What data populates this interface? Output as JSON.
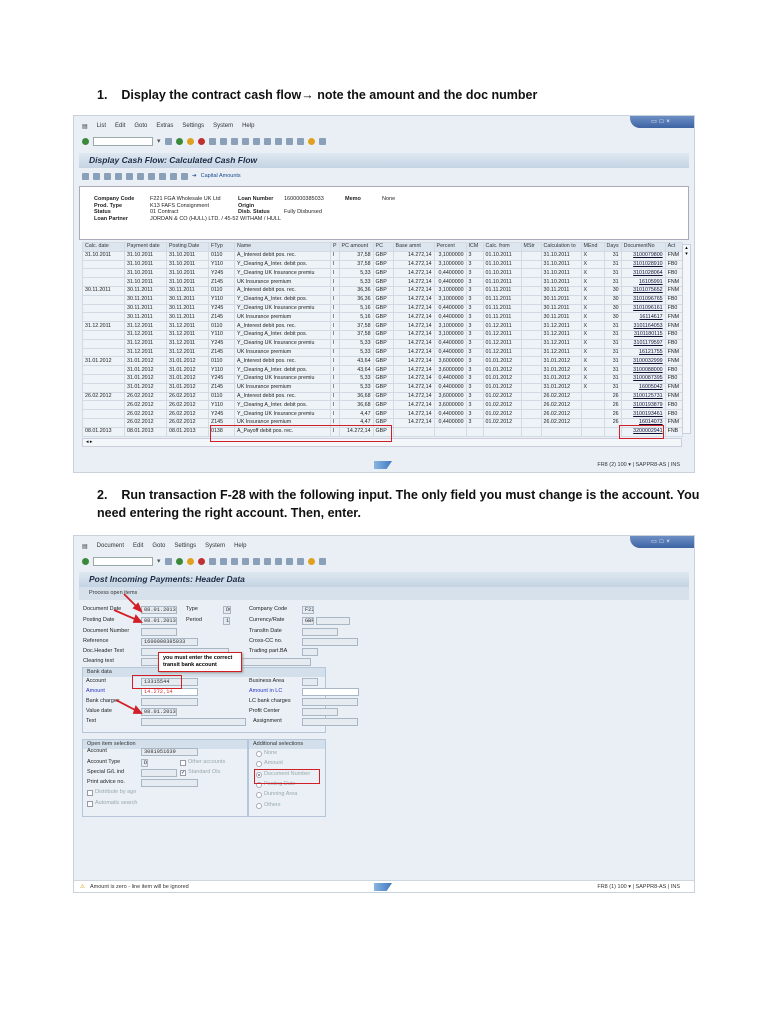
{
  "step1": {
    "number": "1.",
    "text": "Display the contract cash flow→ note the amount and the doc number"
  },
  "step2": {
    "number": "2.",
    "line1": "Run transaction F-28 with the following input. The only field you must change is the account. You",
    "line2": "need entering the right account. Then, enter."
  },
  "screen1": {
    "menu": [
      "List",
      "Edit",
      "Goto",
      "Extras",
      "Settings",
      "System",
      "Help"
    ],
    "title": "Display Cash Flow: Calculated Cash Flow",
    "capital_amounts": "Capital Amounts",
    "header": {
      "company_code_label": "Company Code",
      "company_code": "F221 FGA Wholesale UK Ltd",
      "prod_type_label": "Prod. Type",
      "prod_type": "K13   FAFS Consignment",
      "status_label": "Status",
      "status": "01    Contract",
      "loan_partner_label": "Loan Partner",
      "loan_partner": "JORDAN & CO (HULL) LTD. / 45-52 WITHAM / HULL",
      "loan_number_label": "Loan Number",
      "loan_number": "1600000385033",
      "origin_label": "Origin",
      "disb_status_label": "Disb. Status",
      "disb_status": "Fully Disbursed",
      "memo_label": "Memo",
      "memo": "None"
    },
    "columns": [
      "Calc. date",
      "Payment date",
      "Posting Date",
      "FTyp",
      "Name",
      "P",
      "PC amount",
      "PC",
      "Base amnt",
      "Percent",
      "ICM",
      "Calc. from",
      "MStr",
      "Calculation to",
      "MEnd",
      "Days",
      "DocumentNo",
      "Act"
    ],
    "rows": [
      [
        "31.10.2011",
        "31.10.2011",
        "31.10.2011",
        "0110",
        "A_Interest debit pos. rec.",
        "I",
        "37,58",
        "GBP",
        "14.272,14",
        "3,1000000",
        "3",
        "01.10.2011",
        "",
        "31.10.2011",
        "X",
        "31",
        "3100079800",
        "FNM"
      ],
      [
        "",
        "31.10.2011",
        "31.10.2011",
        "Y110",
        "Y_Clearing A_Inter. debit pos.",
        "I",
        "37,58",
        "GBP",
        "14.272,14",
        "3,1000000",
        "3",
        "01.10.2011",
        "",
        "31.10.2011",
        "X",
        "31",
        "3101028910",
        "FB0"
      ],
      [
        "",
        "31.10.2011",
        "31.10.2011",
        "Y245",
        "Y_Clearing UK Insurance premiu",
        "I",
        "5,33",
        "GBP",
        "14.272,14",
        "0,4400000",
        "3",
        "01.10.2011",
        "",
        "31.10.2011",
        "X",
        "31",
        "3101028064",
        "FB0"
      ],
      [
        "",
        "31.10.2011",
        "31.10.2011",
        "Z145",
        "UK Insurance premium",
        "I",
        "5,33",
        "GBP",
        "14.272,14",
        "0,4400000",
        "3",
        "01.10.2011",
        "",
        "31.10.2011",
        "X",
        "31",
        "16105991",
        "FNM"
      ],
      [
        "30.11.2011",
        "30.11.2011",
        "30.11.2011",
        "0110",
        "A_Interest debit pos. rec.",
        "I",
        "36,36",
        "GBP",
        "14.272,14",
        "3,1000000",
        "3",
        "01.11.2011",
        "",
        "30.11.2011",
        "X",
        "30",
        "3101075652",
        "FNM"
      ],
      [
        "",
        "30.11.2011",
        "30.11.2011",
        "Y110",
        "Y_Clearing A_Inter. debit pos.",
        "I",
        "36,36",
        "GBP",
        "14.272,14",
        "3,1000000",
        "3",
        "01.11.2011",
        "",
        "30.11.2011",
        "X",
        "30",
        "3101096765",
        "FB0"
      ],
      [
        "",
        "30.11.2011",
        "30.11.2011",
        "Y245",
        "Y_Clearing UK Insurance premiu",
        "I",
        "5,16",
        "GBP",
        "14.272,14",
        "0,4400000",
        "3",
        "01.11.2011",
        "",
        "30.11.2011",
        "X",
        "30",
        "3101096161",
        "FB0"
      ],
      [
        "",
        "30.11.2011",
        "30.11.2011",
        "Z145",
        "UK Insurance premium",
        "I",
        "5,16",
        "GBP",
        "14.272,14",
        "0,4400000",
        "3",
        "01.11.2011",
        "",
        "30.11.2011",
        "X",
        "30",
        "16114617",
        "FNM"
      ],
      [
        "31.12.2011",
        "31.12.2011",
        "31.12.2011",
        "0110",
        "A_Interest debit pos. rec.",
        "I",
        "37,58",
        "GBP",
        "14.272,14",
        "3,1000000",
        "3",
        "01.12.2011",
        "",
        "31.12.2011",
        "X",
        "31",
        "3101164053",
        "FNM"
      ],
      [
        "",
        "31.12.2011",
        "31.12.2011",
        "Y110",
        "Y_Clearing A_Inter. debit pos.",
        "I",
        "37,58",
        "GBP",
        "14.272,14",
        "3,1000000",
        "3",
        "01.12.2011",
        "",
        "31.12.2011",
        "X",
        "31",
        "3101180115",
        "FB0"
      ],
      [
        "",
        "31.12.2011",
        "31.12.2011",
        "Y245",
        "Y_Clearing UK Insurance premiu",
        "I",
        "5,33",
        "GBP",
        "14.272,14",
        "0,4400000",
        "3",
        "01.12.2011",
        "",
        "31.12.2011",
        "X",
        "31",
        "3101179597",
        "FB0"
      ],
      [
        "",
        "31.12.2011",
        "31.12.2011",
        "Z145",
        "UK Insurance premium",
        "I",
        "5,33",
        "GBP",
        "14.272,14",
        "0,4400000",
        "3",
        "01.12.2011",
        "",
        "31.12.2011",
        "X",
        "31",
        "16121755",
        "FNM"
      ],
      [
        "31.01.2012",
        "31.01.2012",
        "31.01.2012",
        "0110",
        "A_Interest debit pos. rec.",
        "I",
        "43,64",
        "GBP",
        "14.272,14",
        "3,6000000",
        "3",
        "01.01.2012",
        "",
        "31.01.2012",
        "X",
        "31",
        "3100032999",
        "FNM"
      ],
      [
        "",
        "31.01.2012",
        "31.01.2012",
        "Y110",
        "Y_Clearing A_Inter. debit pos.",
        "I",
        "43,64",
        "GBP",
        "14.272,14",
        "3,6000000",
        "3",
        "01.01.2012",
        "",
        "31.01.2012",
        "X",
        "31",
        "3100088000",
        "FB0"
      ],
      [
        "",
        "31.01.2012",
        "31.01.2012",
        "Y245",
        "Y_Clearing UK Insurance premiu",
        "I",
        "5,33",
        "GBP",
        "14.272,14",
        "0,4400000",
        "3",
        "01.01.2012",
        "",
        "31.01.2012",
        "X",
        "31",
        "3100087395",
        "FB0"
      ],
      [
        "",
        "31.01.2012",
        "31.01.2012",
        "Z145",
        "UK Insurance premium",
        "I",
        "5,33",
        "GBP",
        "14.272,14",
        "0,4400000",
        "3",
        "01.01.2012",
        "",
        "31.01.2012",
        "X",
        "31",
        "16005042",
        "FNM"
      ],
      [
        "26.02.2012",
        "26.02.2012",
        "26.02.2012",
        "0110",
        "A_Interest debit pos. rec.",
        "I",
        "36,68",
        "GBP",
        "14.272,14",
        "3,6000000",
        "3",
        "01.02.2012",
        "",
        "26.02.2012",
        "",
        "26",
        "3100125731",
        "FNM"
      ],
      [
        "",
        "26.02.2012",
        "26.02.2012",
        "Y110",
        "Y_Clearing A_Inter. debit pos.",
        "I",
        "36,68",
        "GBP",
        "14.272,14",
        "3,6000000",
        "3",
        "01.02.2012",
        "",
        "26.02.2012",
        "",
        "26",
        "3100193879",
        "FB0"
      ],
      [
        "",
        "26.02.2012",
        "26.02.2012",
        "Y245",
        "Y_Clearing UK Insurance premiu",
        "I",
        "4,47",
        "GBP",
        "14.272,14",
        "0,4400000",
        "3",
        "01.02.2012",
        "",
        "26.02.2012",
        "",
        "26",
        "3100193461",
        "FB0"
      ],
      [
        "",
        "26.02.2012",
        "26.02.2012",
        "Z145",
        "UK Insurance premium",
        "I",
        "4,47",
        "GBP",
        "14.272,14",
        "0,4400000",
        "3",
        "01.02.2012",
        "",
        "26.02.2012",
        "",
        "26",
        "16014073",
        "FNM"
      ],
      [
        "08.01.2013",
        "08.01.2013",
        "08.01.2013",
        "0138",
        "A_Payoff debit pos. rec.",
        "I",
        "14.272,14",
        "GBP",
        "",
        "",
        "",
        "",
        "",
        "",
        "",
        "",
        "3200002941",
        "FNB"
      ]
    ],
    "status_right": "FR8 (2) 100 ▾ | SAPPR8-AS | INS"
  },
  "screen2": {
    "menu": [
      "Document",
      "Edit",
      "Goto",
      "Settings",
      "System",
      "Help"
    ],
    "title": "Post Incoming Payments: Header Data",
    "process_open_items": "Process open items",
    "fields": {
      "doc_date_label": "Document Date",
      "doc_date": "08.01.2013",
      "type_label": "Type",
      "type": "DC",
      "company_code_label": "Company Code",
      "company_code": "F221",
      "posting_date_label": "Posting Date",
      "posting_date": "08.01.2013",
      "period_label": "Period",
      "period": "1",
      "currency_label": "Currency/Rate",
      "currency": "GBP",
      "doc_number_label": "Document Number",
      "transl_date_label": "Transltn Date",
      "reference_label": "Reference",
      "reference": "1600000385033",
      "cross_cc_label": "Cross-CC no.",
      "doc_header_label": "Doc.Header Text",
      "trading_part_label": "Trading part.BA",
      "clearing_text_label": "Clearing text"
    },
    "bank": {
      "title": "Bank data",
      "account_label": "Account",
      "account": "13315544",
      "amount_label": "Amount",
      "amount": "14.272,14",
      "bank_charges_label": "Bank charges",
      "value_date_label": "Value date",
      "value_date": "08.01.2013",
      "text_label": "Text",
      "business_area_label": "Business Area",
      "amount_lc_label": "Amount in LC",
      "lc_charges_label": "LC bank charges",
      "profit_center_label": "Profit Center",
      "assignment_label": "Assignment"
    },
    "tooltip": "you must enter the correct transit bank account",
    "open_items": {
      "title": "Open item selection",
      "account_label": "Account",
      "account": "3081051639",
      "account_type_label": "Account Type",
      "account_type": "D",
      "other_accounts": "Other accounts",
      "special_gl_label": "Special G/L ind",
      "standard_ois": "Standard OIs",
      "print_advice_label": "Print advice no.",
      "distribute_by_age": "Distribute by age",
      "automatic_search": "Automatic search"
    },
    "additional": {
      "title": "Additional selections",
      "options": [
        "None",
        "Amount",
        "Document Number",
        "Posting Date",
        "Dunning Area",
        "Others"
      ],
      "selected": "Document Number"
    },
    "status_message": "Amount is zero - line item will be ignored",
    "status_right": "FR8 (1) 100 ▾ | SAPPR8-AS | INS"
  }
}
